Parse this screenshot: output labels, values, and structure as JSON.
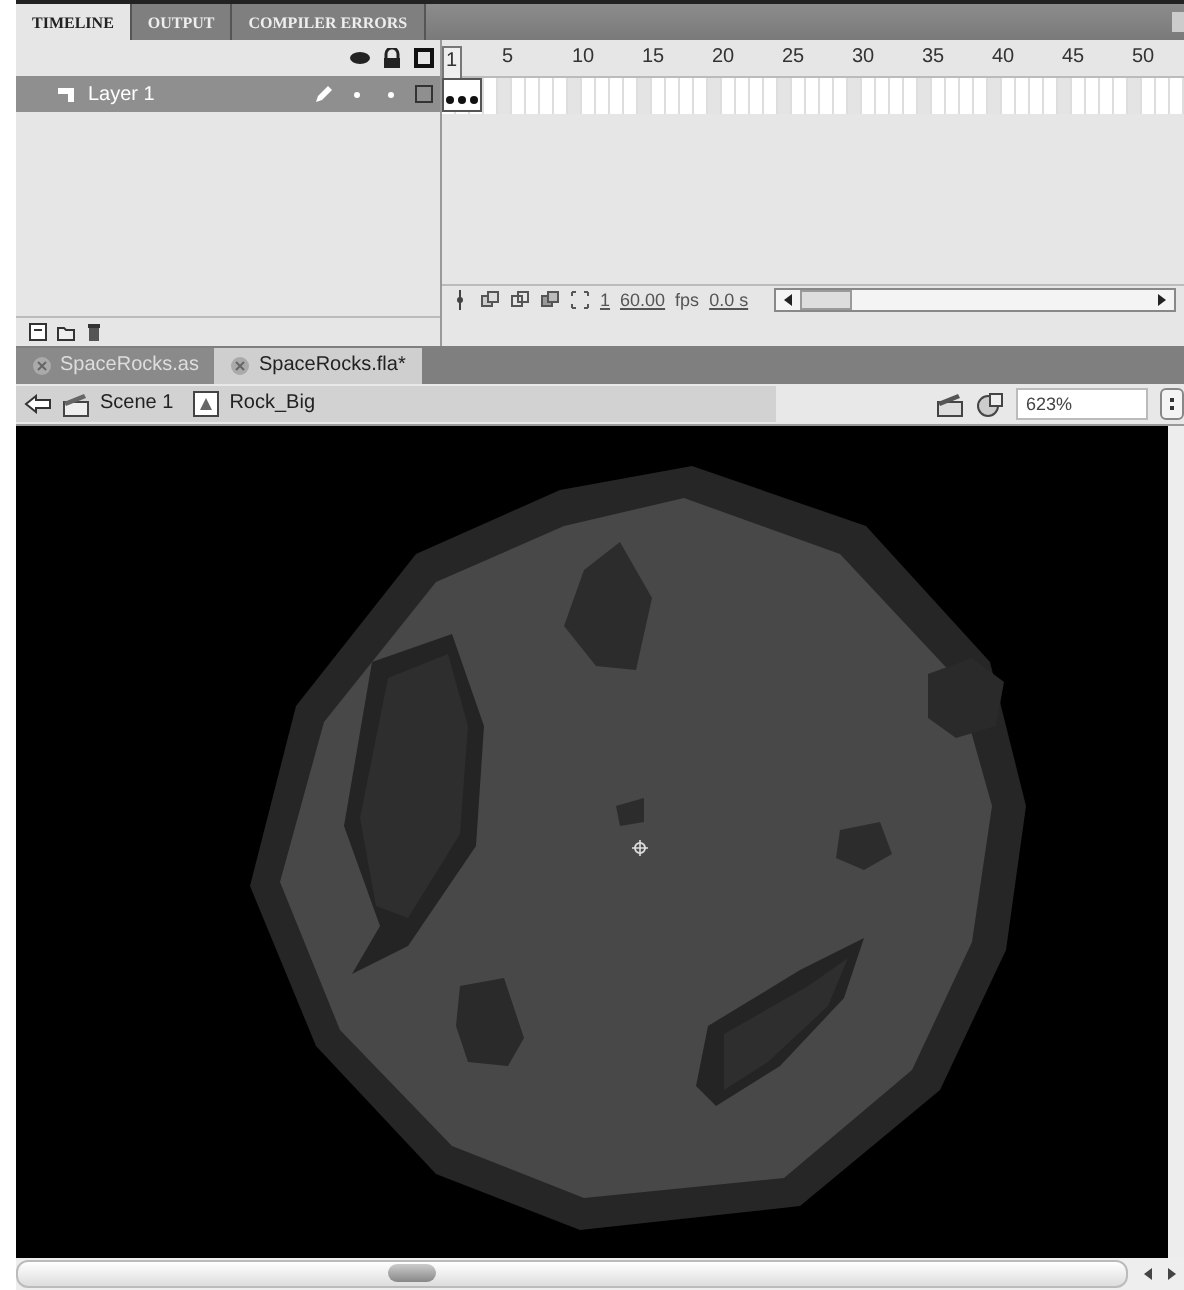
{
  "panel_tabs": [
    {
      "label": "TIMELINE",
      "selected": true
    },
    {
      "label": "OUTPUT",
      "selected": false
    },
    {
      "label": "COMPILER ERRORS",
      "selected": false
    }
  ],
  "timeline": {
    "frame_numbers": [
      "1",
      "5",
      "10",
      "15",
      "20",
      "25",
      "30",
      "35",
      "40",
      "45",
      "50"
    ],
    "layers": [
      {
        "name": "Layer 1",
        "selected": true
      }
    ],
    "current_frame": "1",
    "frame_rate": "60.00",
    "frame_rate_unit": "fps",
    "elapsed_time": "0.0 s"
  },
  "document_tabs": [
    {
      "label": "SpaceRocks.as",
      "selected": false
    },
    {
      "label": "SpaceRocks.fla*",
      "selected": true
    }
  ],
  "breadcrumbs": [
    {
      "label": "Scene 1",
      "kind": "scene"
    },
    {
      "label": "Rock_Big",
      "kind": "symbol"
    }
  ],
  "zoom": {
    "value": "623%"
  }
}
